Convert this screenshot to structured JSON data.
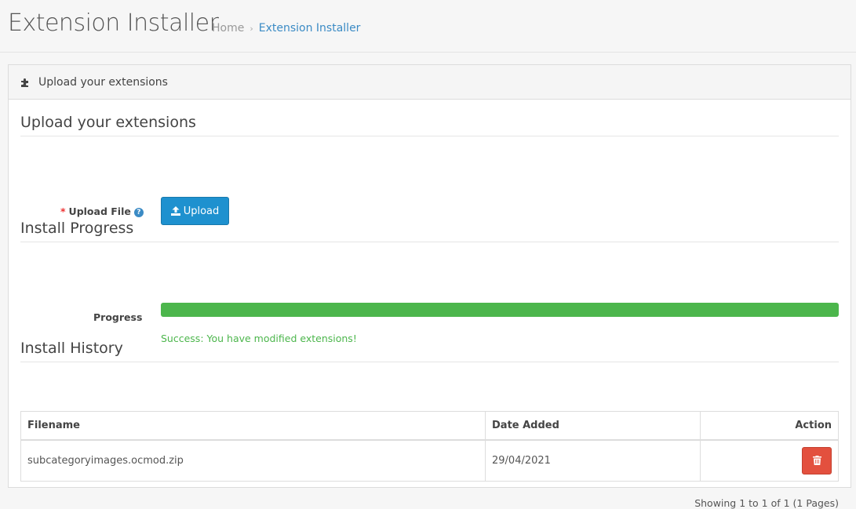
{
  "header": {
    "title": "Extension Installer",
    "breadcrumb": [
      "Home",
      "Extension Installer"
    ]
  },
  "panel": {
    "heading": "Upload your extensions",
    "icon": "puzzle-icon"
  },
  "upload_section": {
    "legend": "Upload your extensions",
    "label": "Upload File",
    "button_label": "Upload"
  },
  "progress_section": {
    "legend": "Install Progress",
    "label": "Progress",
    "progress_fraction": 1.0,
    "message": "Success: You have modified extensions!"
  },
  "history_section": {
    "legend": "Install History",
    "columns": [
      "Filename",
      "Date Added",
      "Action"
    ],
    "rows": [
      {
        "filename": "subcategoryimages.ocmod.zip",
        "date_added": "29/04/2021"
      }
    ],
    "pagination_text": "Showing 1 to 1 of 1 (1 Pages)"
  },
  "colors": {
    "primary": "#1e91cf",
    "success": "#4cb64c",
    "danger": "#e3503e",
    "link": "#3b8bc5"
  }
}
